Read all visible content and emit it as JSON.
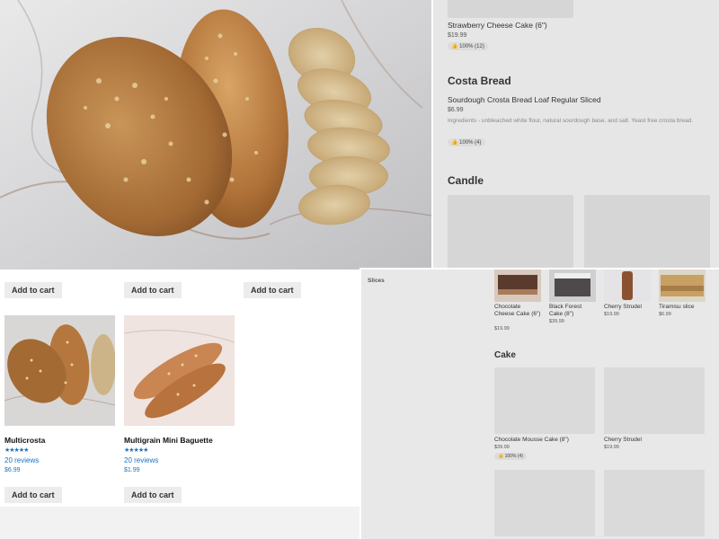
{
  "hero": {
    "image": "bread-loaves-photo"
  },
  "menu": {
    "top_item": {
      "name": "Strawberry Cheese Cake (6\")",
      "price": "$19.99",
      "rating": "100% (12)"
    },
    "section_bread": "Costa Bread",
    "bread_item": {
      "name": "Sourdough Crosta Bread Loaf Regular Sliced",
      "price": "$6.99",
      "description": "Ingredients - unbleached white flour, natural sourdough base, and salt. Yeast free crosta bread.",
      "rating": "100% (4)"
    },
    "section_candle": "Candle"
  },
  "shop": {
    "add_to_cart": "Add to cart",
    "products": [
      {
        "title": "Multicrosta",
        "stars": "★★★★★",
        "reviews": "20 reviews",
        "price": "$6.99",
        "image": "multicrosta-bread-photo"
      },
      {
        "title": "Multigrain Mini Baguette",
        "stars": "★★★★★",
        "reviews": "20 reviews",
        "price": "$1.99",
        "image": "mini-baguette-photo"
      }
    ]
  },
  "cakes": {
    "sidebar_label": "Slices",
    "slices": [
      {
        "name": "Chocolate Cheese Cake (6\")",
        "price": "$19.99"
      },
      {
        "name": "Black Forest Cake (8\")",
        "price": "$39.99"
      },
      {
        "name": "Cherry Strudel",
        "price": "$19.99"
      },
      {
        "name": "Tiramisu slice",
        "price": "$6.99"
      }
    ],
    "section_cake": "Cake",
    "cake_items": [
      {
        "name": "Chocolate Mousse Cake (8\")",
        "price": "$39.99",
        "rating": "100% (4)"
      },
      {
        "name": "Cherry Strudel",
        "price": "$19.99"
      }
    ]
  }
}
